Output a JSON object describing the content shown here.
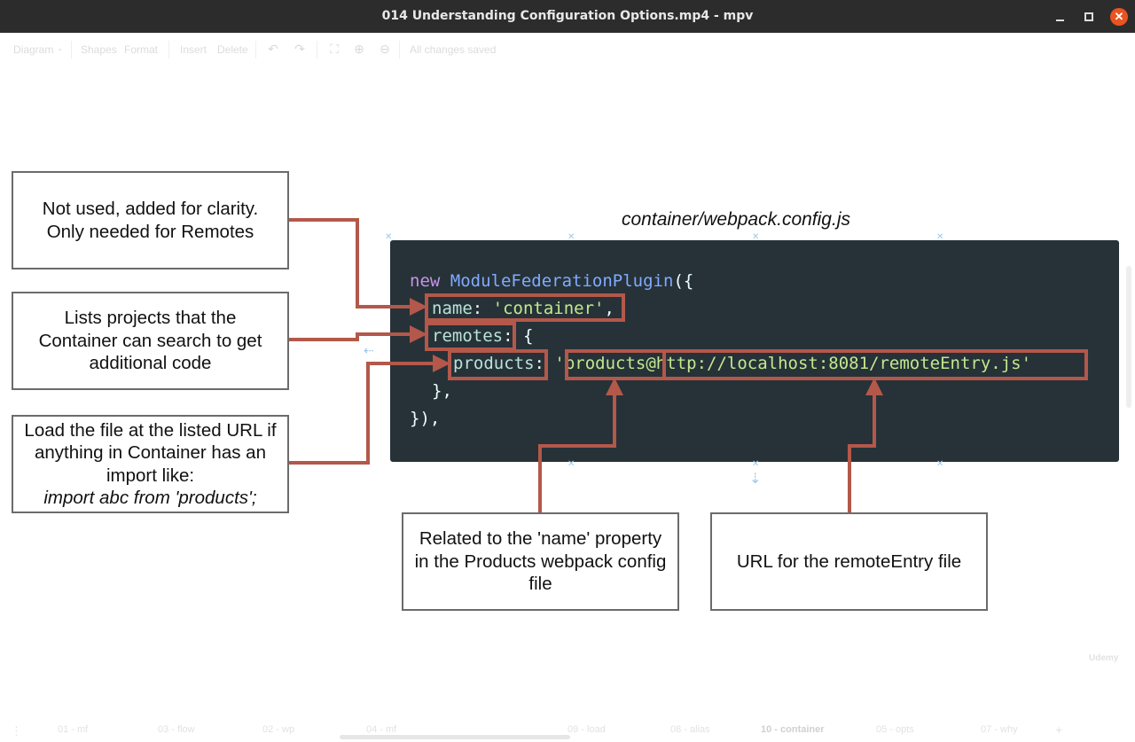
{
  "window": {
    "title": "014 Understanding Configuration Options.mp4 - mpv",
    "close_glyph": "✕"
  },
  "toolbar": {
    "diagram": "Diagram",
    "shapes": "Shapes",
    "format": "Format",
    "insert": "Insert",
    "delete": "Delete",
    "status": "All changes saved",
    "icons": [
      "undo-icon",
      "redo-icon",
      "fullscreen-icon",
      "zoom-in-icon",
      "zoom-out-icon"
    ]
  },
  "caption": "container/webpack.config.js",
  "code": {
    "line1_kw": "new",
    "line1_cls": "ModuleFederationPlugin",
    "line1_tail": "({",
    "line2_prop": "name",
    "line2_colon": ":",
    "line2_str": "'container'",
    "line2_comma": ",",
    "line3_prop": "remotes",
    "line3_tail": ": {",
    "line4_prop": "products",
    "line4_colon": ":",
    "line4_str": "'products@http://localhost:8081/remoteEntry.js'",
    "line5": "},",
    "line6": "}),"
  },
  "notes": {
    "name_note": [
      "Not used, added for clarity.",
      "Only needed for Remotes"
    ],
    "remotes_note": [
      "Lists projects that the",
      "Container can search to get",
      "additional code"
    ],
    "products_note": [
      "Load the file at the listed URL if",
      "anything in Container has an",
      "import like:",
      "import abc from 'products';"
    ],
    "name_property_note": [
      "Related to the 'name' property",
      "in the Products webpack config",
      "file"
    ],
    "url_note": "URL for the remoteEntry file"
  },
  "tabs": [
    "01 - mf",
    "03 - flow",
    "02 - wp",
    "04 - mf",
    "09 - load",
    "08 - alias",
    "10 - container",
    "05 - opts",
    "07 - why"
  ],
  "active_tab": "10 - container",
  "watermark": "Udemy",
  "colors": {
    "code_background": "#263238",
    "annotation": "#b3584a",
    "keyword": "#c792ea",
    "class": "#82aaff",
    "string": "#c3e88d"
  }
}
